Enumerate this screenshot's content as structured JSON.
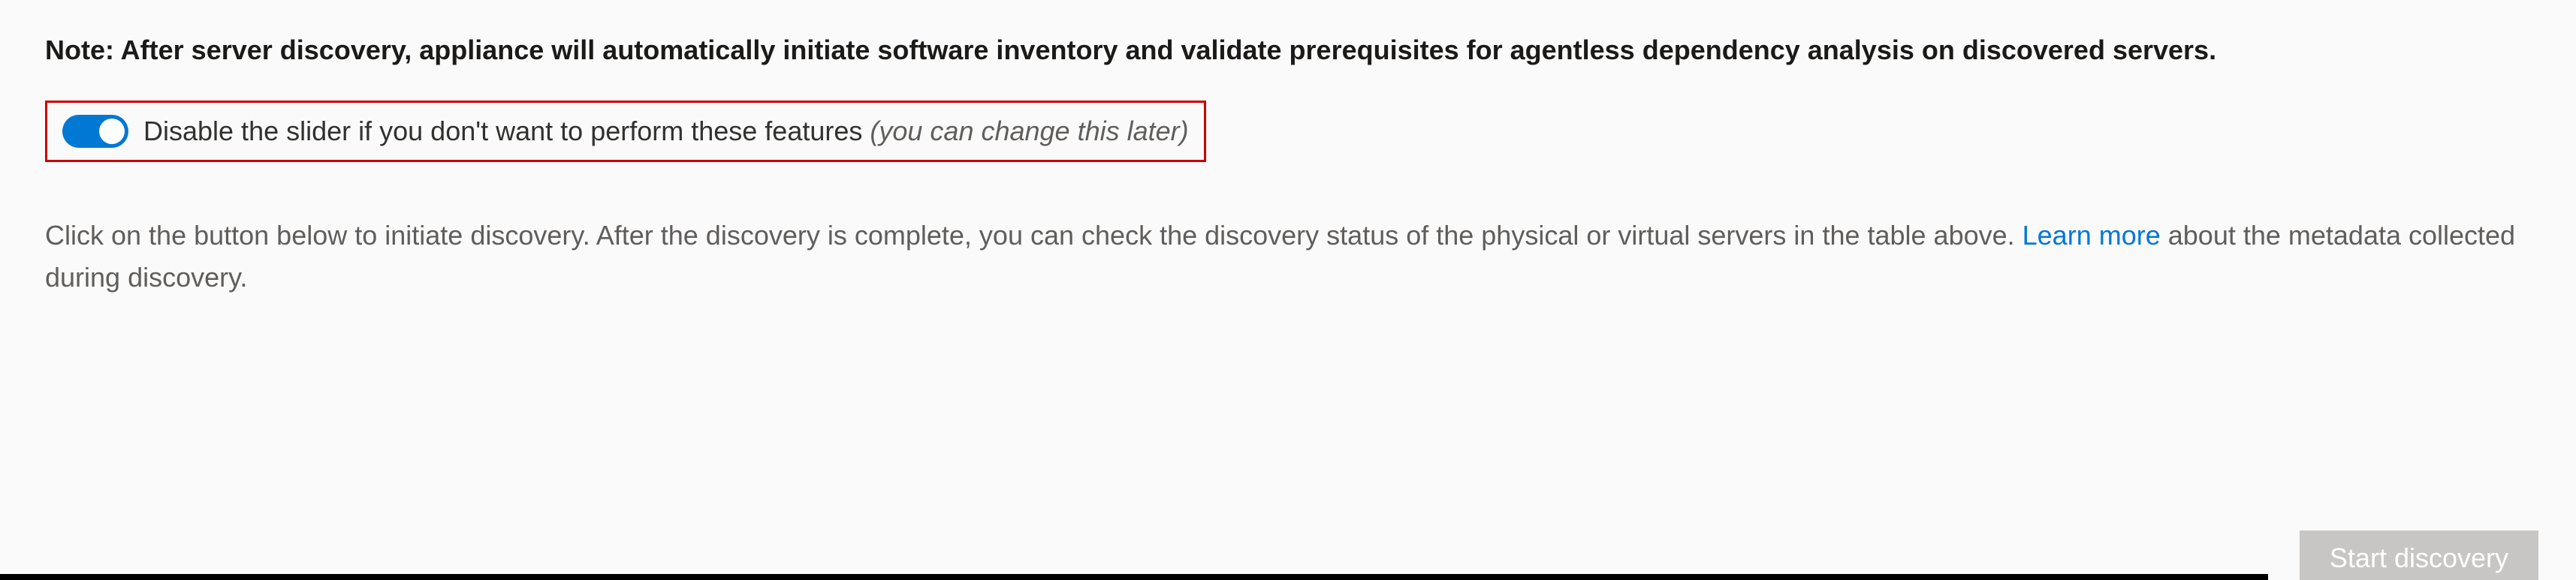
{
  "note": {
    "prefix": "Note:",
    "text": "After server discovery, appliance will automatically initiate software inventory and validate prerequisites for agentless dependency analysis on discovered servers."
  },
  "slider": {
    "enabled": true,
    "label": "Disable the slider if you don't want to perform these features",
    "hint": "(you can change this later)"
  },
  "description": {
    "part1": "Click on the button below to initiate discovery. After the discovery is complete, you can check the discovery status of the physical or virtual servers in the table above. ",
    "link_text": "Learn more",
    "part2": " about the metadata collected during discovery."
  },
  "actions": {
    "start_discovery": "Start discovery"
  }
}
